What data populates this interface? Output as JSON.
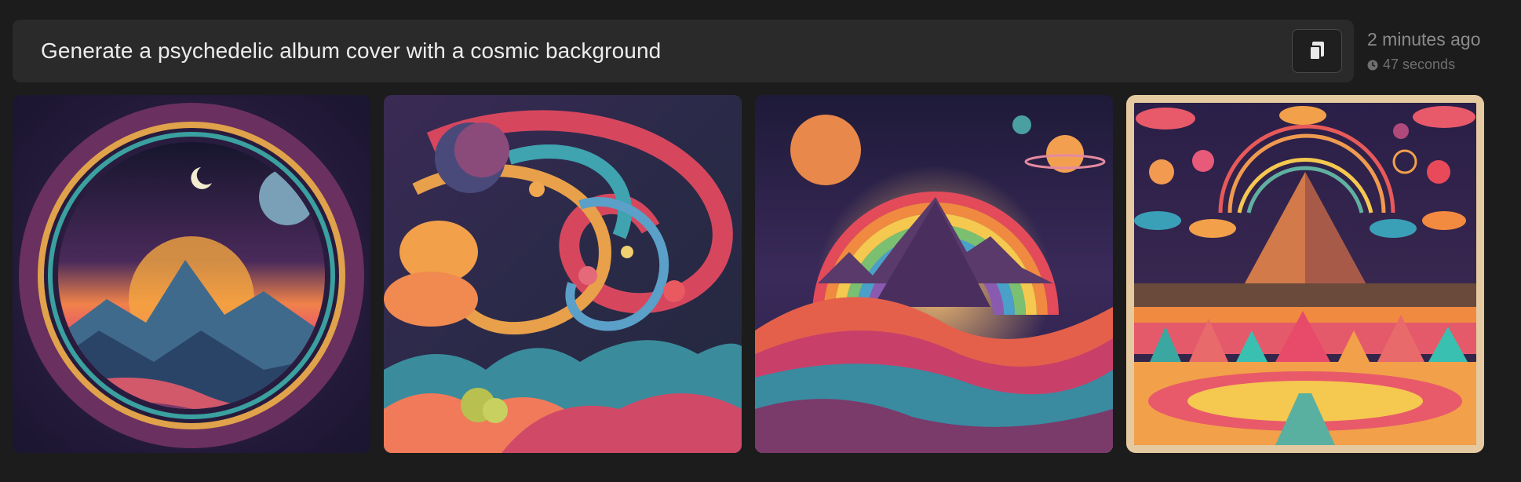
{
  "prompt": {
    "text": "Generate a psychedelic album cover with a cosmic background",
    "copy_icon": "copy-icon"
  },
  "meta": {
    "created": "2 minutes ago",
    "duration": "47 seconds",
    "duration_icon": "clock-icon"
  },
  "gallery": {
    "selected_index": 3,
    "selected_border_color": "#e5c9a0",
    "images": [
      {
        "subject": "circular portal framing mountains and a crescent moon"
      },
      {
        "subject": "swirling cosmic clouds with planets"
      },
      {
        "subject": "rainbow arc over a purple mountain peak"
      },
      {
        "subject": "pyramid with rainbow arch and rows of triangles"
      }
    ]
  }
}
